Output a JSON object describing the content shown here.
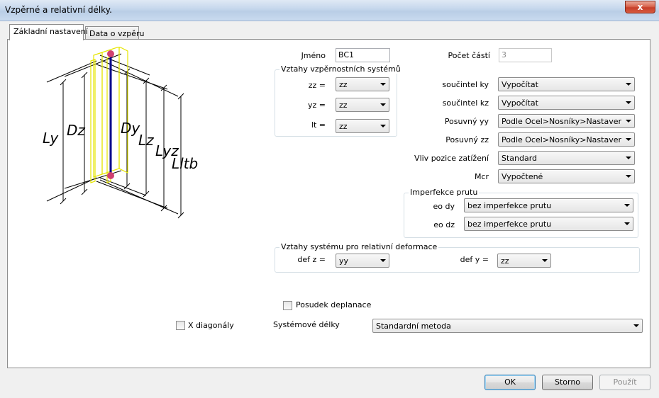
{
  "window": {
    "title": "Vzpěrné a relativní délky.",
    "close": "x"
  },
  "tabs": [
    "Základní nastavení",
    "Data o vzpěru"
  ],
  "diagram": {
    "labels": [
      "Ly",
      "Dz",
      "Dy",
      "Lz",
      "Lyz",
      "Lltb"
    ]
  },
  "form": {
    "name_label": "Jméno",
    "name_value": "BC1",
    "parts_label": "Počet částí",
    "parts_value": "3",
    "buckling_group": {
      "title": "Vztahy vzpěrnostních systémů",
      "rows": [
        {
          "label": "zz =",
          "value": "zz"
        },
        {
          "label": "yz =",
          "value": "zz"
        },
        {
          "label": "lt =",
          "value": "zz"
        }
      ]
    },
    "right_rows": [
      {
        "label": "součintel ky",
        "value": "Vypočítat"
      },
      {
        "label": "součintel kz",
        "value": "Vypočítat"
      },
      {
        "label": "Posuvný yy",
        "value": "Podle Ocel>Nosníky>Nastavení"
      },
      {
        "label": "Posuvný zz",
        "value": "Podle Ocel>Nosníky>Nastavení"
      },
      {
        "label": "Vliv pozice zatížení",
        "value": "Standard"
      },
      {
        "label": "Mcr",
        "value": "Vypočtené"
      }
    ],
    "imperfection_group": {
      "title": "Imperfekce prutu",
      "rows": [
        {
          "label": "eo dy",
          "value": "bez imperfekce prutu"
        },
        {
          "label": "eo dz",
          "value": "bez imperfekce prutu"
        }
      ]
    },
    "deformation_group": {
      "title": "Vztahy systému pro relativní deformace",
      "defz_label": "def z =",
      "defz_value": "yy",
      "defy_label": "def y =",
      "defy_value": "zz"
    },
    "warping_check": "Posudek deplanace",
    "x_diagonals": "X diagonály",
    "system_lengths_label": "Systémové délky",
    "system_lengths_value": "Standardní metoda"
  },
  "buttons": {
    "ok": "OK",
    "cancel": "Storno",
    "apply": "Použít"
  }
}
